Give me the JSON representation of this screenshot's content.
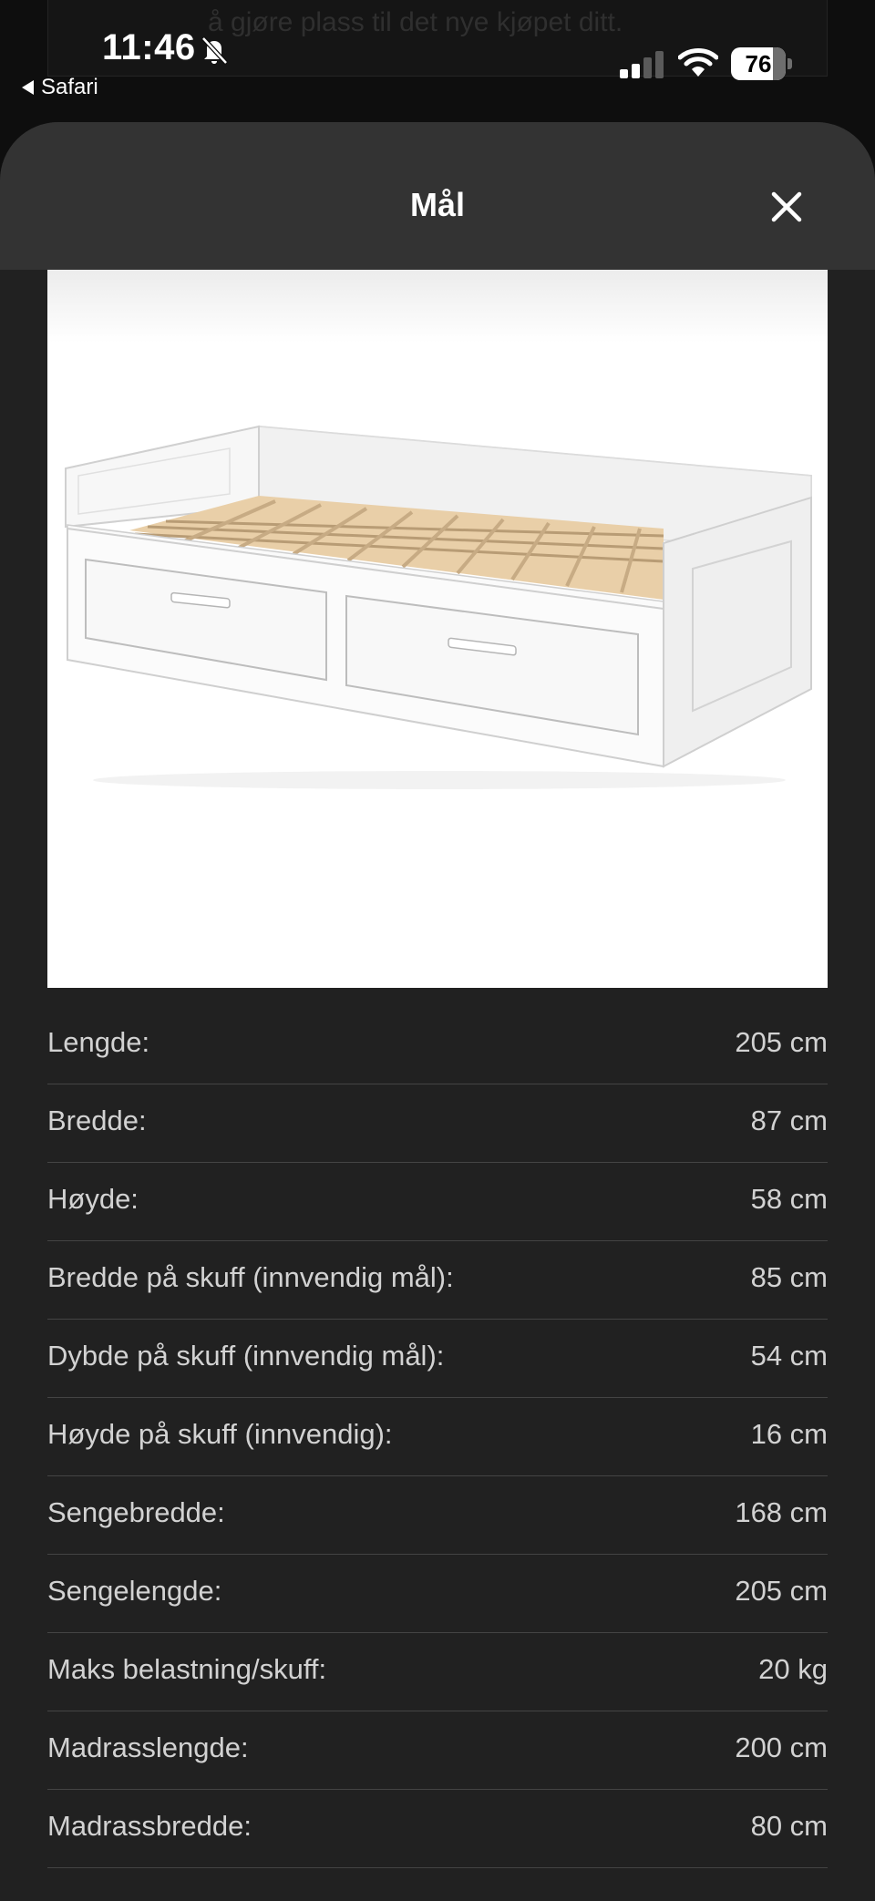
{
  "background_page": {
    "text": "å gjøre plass til det nye kjøpet ditt."
  },
  "status_bar": {
    "time": "11:46",
    "back_app": "Safari",
    "battery": "76"
  },
  "sheet": {
    "title": "Mål",
    "close_icon": "close-icon"
  },
  "product_image": {
    "description_icon": "daybed-image"
  },
  "specs": [
    {
      "label": "Lengde:",
      "value": "205 cm"
    },
    {
      "label": "Bredde:",
      "value": "87 cm"
    },
    {
      "label": "Høyde:",
      "value": "58 cm"
    },
    {
      "label": "Bredde på skuff (innvendig mål):",
      "value": "85 cm"
    },
    {
      "label": "Dybde på skuff (innvendig mål):",
      "value": "54 cm"
    },
    {
      "label": "Høyde på skuff (innvendig):",
      "value": "16 cm"
    },
    {
      "label": "Sengebredde:",
      "value": "168 cm"
    },
    {
      "label": "Sengelengde:",
      "value": "205 cm"
    },
    {
      "label": "Maks belastning/skuff:",
      "value": "20 kg"
    },
    {
      "label": "Madrasslengde:",
      "value": "200 cm"
    },
    {
      "label": "Madrassbredde:",
      "value": "80 cm"
    }
  ],
  "colors": {
    "sheet_bg": "#212121",
    "header_bg": "#333333",
    "text": "#d2d2d2"
  }
}
